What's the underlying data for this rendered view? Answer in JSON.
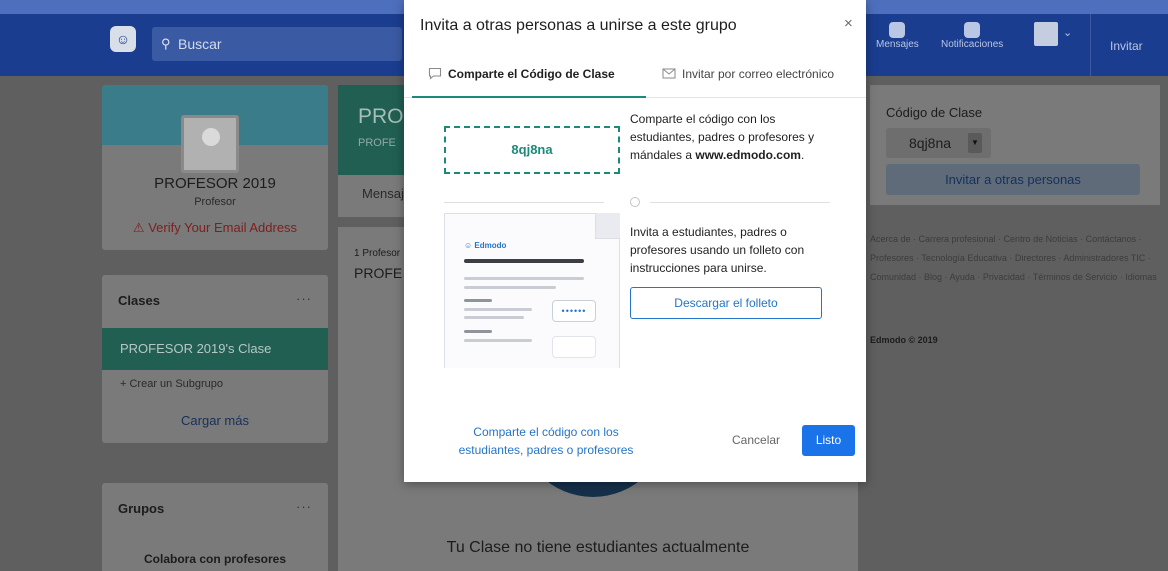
{
  "header": {
    "search_label": "Buscar",
    "messages_label": "Mensajes",
    "notifications_label": "Notificaciones",
    "invite_label": "Invitar"
  },
  "profile": {
    "name": "PROFESOR 2019",
    "role": "Profesor",
    "verify": "Verify Your Email Address"
  },
  "classes": {
    "title": "Clases",
    "more": "···",
    "active_class": "PROFESOR 2019's Clase",
    "subgroup": "+ Crear un Subgrupo",
    "load_more": "Cargar más"
  },
  "groups": {
    "title": "Grupos",
    "more": "···",
    "collab": "Colabora con profesores"
  },
  "main": {
    "title": "PRO",
    "subtitle": "PROFE",
    "tab": "Mensaj",
    "member_count": "1 Profesor",
    "member_name": "PROFE",
    "empty_text": "Tu Clase no tiene estudiantes actualmente"
  },
  "right": {
    "code_label": "Código de Clase",
    "code_value": "8qj8na",
    "invite_button": "Invitar a otras personas",
    "footer_links": "Acerca de · Carrera profesional · Centro de Noticias · Contáctanos · Profesores · Tecnología Educativa · Directores · Administradores TIC · Comunidad · Blog · Ayuda · Privacidad · Términos de Servicio · Idiomas",
    "copyright": "Edmodo © 2019"
  },
  "modal": {
    "title": "Invita a otras personas a unirse a este grupo",
    "close": "×",
    "tab_share": "Comparte el Código de Clase",
    "tab_email": "Invitar por correo electrónico",
    "code": "8qj8na",
    "code_desc": "Comparte el código con los estudiantes, padres o profesores y mándales a",
    "code_url": "www.edmodo.com",
    "code_desc_end": ".",
    "flyer_desc": "Invita a estudiantes, padres o profesores usando un folleto con instrucciones para unirse.",
    "flyer_brand": "Edmodo",
    "flyer_pill": "••••••",
    "download_button": "Descargar el folleto",
    "footer_link": "Comparte el código con los estudiantes, padres o profesores",
    "cancel": "Cancelar",
    "done": "Listo"
  },
  "colors": {
    "accent_teal": "#1b8a78",
    "primary_blue": "#1a73e8",
    "topbar_blue": "#1a3d8f",
    "overlay": "#5f5f5f"
  },
  "icons": [
    "logo-icon",
    "search-icon",
    "messages-icon",
    "notifications-icon",
    "avatar-icon",
    "chevron-down-icon",
    "warning-icon",
    "close-icon",
    "chat-bubble-icon",
    "envelope-icon"
  ]
}
